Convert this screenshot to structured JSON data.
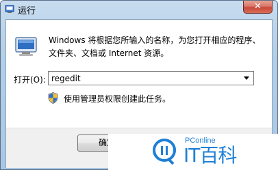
{
  "window": {
    "title": "运行",
    "close_symbol": "✕"
  },
  "dialog": {
    "description": "Windows 将根据您所输入的名称，为您打开相应的程序、文件夹、文档或 Internet 资源。",
    "open_label": "打开(O):",
    "open_value": "regedit",
    "admin_note": "使用管理员权限创建此任务。",
    "ok_label": "确定"
  },
  "watermark": {
    "brand": "PConline",
    "name": "IT百科"
  },
  "icons": {
    "app": "run-icon",
    "shield": "uac-shield-icon",
    "dropdown": "chevron-down-icon"
  },
  "colors": {
    "frame": "#b4cfe8",
    "close_button": "#c8483a",
    "watermark_blue": "#1e7fd6"
  }
}
